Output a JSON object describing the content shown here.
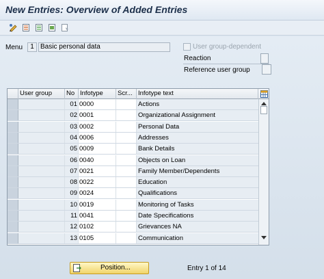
{
  "title": "New Entries: Overview of Added Entries",
  "toolbar": {
    "buttons": [
      {
        "name": "display-change-icon"
      },
      {
        "name": "new-entries-icon"
      },
      {
        "name": "copy-as-icon"
      },
      {
        "name": "delete-icon"
      },
      {
        "name": "undo-change-icon"
      }
    ]
  },
  "menu": {
    "label": "Menu",
    "code": "1",
    "value": "Basic personal data"
  },
  "options": {
    "user_group_dependent_label": "User group-dependent",
    "reaction_label": "Reaction",
    "reference_user_group_label": "Reference user group"
  },
  "table": {
    "headers": {
      "user_group": "User group",
      "no": "No",
      "infotype": "Infotype",
      "scr": "Scr...",
      "text": "Infotype text"
    },
    "rows": [
      {
        "no": "01",
        "infotype": "0000",
        "text": "Actions"
      },
      {
        "no": "02",
        "infotype": "0001",
        "text": "Organizational Assignment"
      },
      {
        "no": "03",
        "infotype": "0002",
        "text": "Personal Data"
      },
      {
        "no": "04",
        "infotype": "0006",
        "text": "Addresses"
      },
      {
        "no": "05",
        "infotype": "0009",
        "text": "Bank Details"
      },
      {
        "no": "06",
        "infotype": "0040",
        "text": "Objects on Loan"
      },
      {
        "no": "07",
        "infotype": "0021",
        "text": "Family Member/Dependents"
      },
      {
        "no": "08",
        "infotype": "0022",
        "text": "Education"
      },
      {
        "no": "09",
        "infotype": "0024",
        "text": "Qualifications"
      },
      {
        "no": "10",
        "infotype": "0019",
        "text": "Monitoring of Tasks"
      },
      {
        "no": "11",
        "infotype": "0041",
        "text": "Date Specifications"
      },
      {
        "no": "12",
        "infotype": "0102",
        "text": "Grievances NA"
      },
      {
        "no": "13",
        "infotype": "0105",
        "text": "Communication"
      }
    ]
  },
  "footer": {
    "position_button": "Position...",
    "entry_status": "Entry 1 of 14"
  },
  "colors": {
    "title_text": "#1c2f4a",
    "button_highlight": "#f1d46a"
  }
}
